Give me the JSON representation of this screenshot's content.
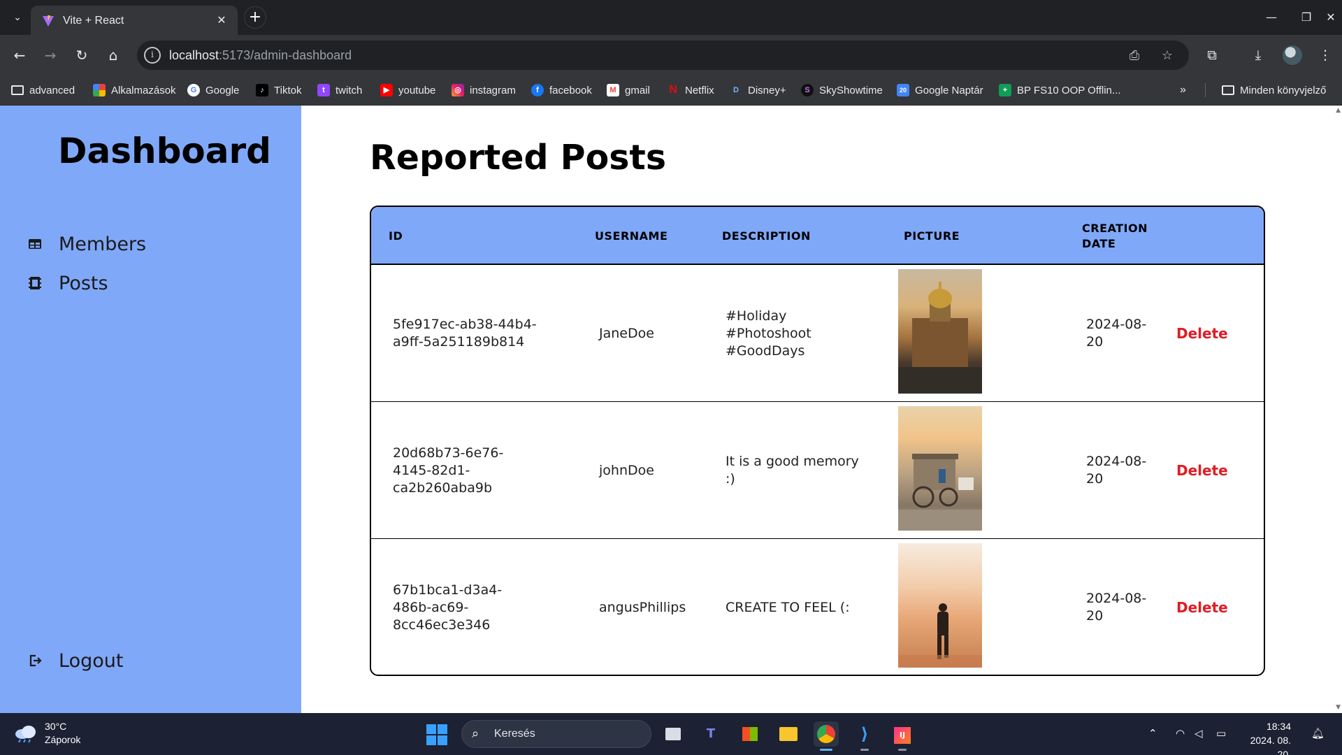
{
  "browser": {
    "tab_title": "Vite + React",
    "url_host": "localhost",
    "url_path": ":5173/admin-dashboard",
    "bookmarks": [
      {
        "label": "advanced",
        "icon": "folder-icon"
      },
      {
        "label": "Alkalmazások",
        "icon": "apps-grid-icon"
      },
      {
        "label": "Google",
        "icon": "google-icon"
      },
      {
        "label": "Tiktok",
        "icon": "tiktok-icon"
      },
      {
        "label": "twitch",
        "icon": "twitch-icon"
      },
      {
        "label": "youtube",
        "icon": "youtube-icon"
      },
      {
        "label": "instagram",
        "icon": "instagram-icon"
      },
      {
        "label": "facebook",
        "icon": "facebook-icon"
      },
      {
        "label": "gmail",
        "icon": "gmail-icon"
      },
      {
        "label": "Netflix",
        "icon": "netflix-icon"
      },
      {
        "label": "Disney+",
        "icon": "disney-icon"
      },
      {
        "label": "SkyShowtime",
        "icon": "skyshowtime-icon"
      },
      {
        "label": "Google Naptár",
        "icon": "calendar-icon"
      },
      {
        "label": "BP FS10 OOP Offlin...",
        "icon": "sheets-icon"
      }
    ],
    "other_bookmarks": "Minden könyvjelző"
  },
  "sidebar": {
    "brand": "Dashboard",
    "items": [
      {
        "label": "Members",
        "icon": "table-icon"
      },
      {
        "label": "Posts",
        "icon": "posts-icon"
      }
    ],
    "logout": "Logout"
  },
  "main": {
    "title": "Reported Posts",
    "columns": [
      "ID",
      "USERNAME",
      "DESCRIPTION",
      "PICTURE",
      "CREATION DATE"
    ],
    "rows": [
      {
        "id": "5fe917ec-ab38-44b4-a9ff-5a251189b814",
        "username": "JaneDoe",
        "description": "#Holiday #Photoshoot #GoodDays",
        "date": "2024-08-20",
        "action": "Delete"
      },
      {
        "id": "20d68b73-6e76-4145-82d1-ca2b260aba9b",
        "username": "johnDoe",
        "description": "It is a good memory :)",
        "date": "2024-08-20",
        "action": "Delete"
      },
      {
        "id": "67b1bca1-d3a4-486b-ac69-8cc46ec3e346",
        "username": "angusPhillips",
        "description": "CREATE TO FEEL (:",
        "date": "2024-08-20",
        "action": "Delete"
      }
    ]
  },
  "taskbar": {
    "temperature": "30°C",
    "weather": "Záporok",
    "search_label": "Keresés",
    "time": "18:34",
    "date": "2024. 08. 20."
  },
  "colors": {
    "accent": "#80a8f8",
    "delete": "#e01b24",
    "chrome_dark": "#202124"
  }
}
